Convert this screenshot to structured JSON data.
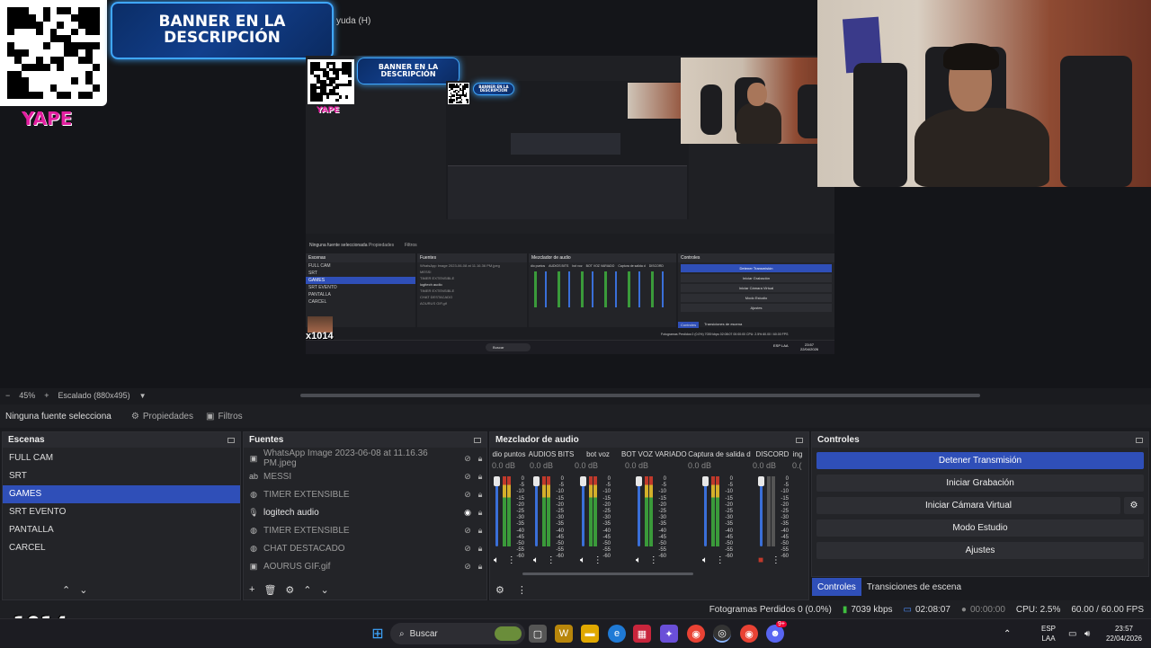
{
  "stream_overlay": {
    "banner_text": "BANNER EN LA DESCRIPCIÓN",
    "yape_label": "YAPE",
    "webcam_tag": "x1014"
  },
  "obs_menu": {
    "help_item": "yuda (H)"
  },
  "nested_preview": {
    "banner_text": "BANNER EN LA DESCRIPCIÓN",
    "yape_label": "YAPE",
    "context_label": "Ninguna fuente seleccionada",
    "properties": "Propiedades",
    "filters": "Filtros",
    "docks": [
      "Escenas",
      "Fuentes",
      "Mezclador de audio",
      "Controles"
    ],
    "scenes": [
      "FULL CAM",
      "SRT",
      "GAMES",
      "SRT EVENTO",
      "PANTALLA",
      "CARCEL"
    ],
    "sources": [
      "WhatsApp Image 2023-06-08 at 11.16.36 PM.jpeg",
      "MESSI",
      "TIMER EXTENSIBLE",
      "logitech audio",
      "TIMER EXTENSIBLE",
      "CHAT DESTACADO",
      "AOURUS GIF.gif"
    ],
    "mixer_channels": [
      "dio puntos",
      "AUDIOS BITS",
      "bot voz",
      "BOT VOZ VARIADO",
      "Captura de salida d",
      "DISCORD"
    ],
    "controls": [
      "Detener Transmisión",
      "Iniciar Grabación",
      "Iniciar Cámara Virtual",
      "Modo Estudio",
      "Ajustes"
    ],
    "tabs": [
      "Controles",
      "Transiciones de escena"
    ],
    "status": "Fotogramas Perdidos 0 (0.0%)  7039 kbps  02:08:07  00:00:00  CPU: 2.5%  60.00 / 60.00 FPS",
    "taskbar_search": "Buscar",
    "tray_lang": "ESP LAA",
    "tray_time": "23:57",
    "tray_date": "22/04/2026",
    "webcam_tag": "x1014"
  },
  "zoom": {
    "minus": "−",
    "value": "45%",
    "plus": "+",
    "mode": "Escalado (880x495)"
  },
  "context_bar": {
    "label": "Ninguna fuente selecciona",
    "properties": "Propiedades",
    "filters": "Filtros"
  },
  "scenes": {
    "title": "Escenas",
    "items": [
      "FULL CAM",
      "SRT",
      "GAMES",
      "SRT EVENTO",
      "PANTALLA",
      "CARCEL"
    ],
    "selected_index": 2
  },
  "sources": {
    "title": "Fuentes",
    "items": [
      {
        "name": "WhatsApp Image 2023-06-08 at 11.16.36 PM.jpeg",
        "icon": "image-icon",
        "visible": false
      },
      {
        "name": "MESSI",
        "icon": "text-icon",
        "visible": false
      },
      {
        "name": "TIMER EXTENSIBLE",
        "icon": "browser-icon",
        "visible": false
      },
      {
        "name": "logitech audio",
        "icon": "microphone-icon",
        "visible": true
      },
      {
        "name": "TIMER EXTENSIBLE",
        "icon": "browser-icon",
        "visible": false
      },
      {
        "name": "CHAT DESTACADO",
        "icon": "browser-icon",
        "visible": false
      },
      {
        "name": "AOURUS GIF.gif",
        "icon": "image-icon",
        "visible": false
      }
    ]
  },
  "mixer": {
    "title": "Mezclador de audio",
    "channels": [
      {
        "name": "dio puntos",
        "db": "0.0 dB"
      },
      {
        "name": "AUDIOS BITS",
        "db": "0.0 dB"
      },
      {
        "name": "bot voz",
        "db": "0.0 dB"
      },
      {
        "name": "BOT VOZ VARIADO",
        "db": "0.0 dB"
      },
      {
        "name": "Captura de salida d",
        "db": "0.0 dB"
      },
      {
        "name": "DISCORD",
        "db": "0.0 dB"
      },
      {
        "name": "ing",
        "db": "0.("
      }
    ],
    "scale": [
      "0",
      "-5",
      "-10",
      "-15",
      "-20",
      "-25",
      "-30",
      "-35",
      "-40",
      "-45",
      "-50",
      "-55",
      "-60"
    ]
  },
  "controls": {
    "title": "Controles",
    "stop_stream": "Detener Transmisión",
    "start_recording": "Iniciar Grabación",
    "start_virtual_cam": "Iniciar Cámara Virtual",
    "studio_mode": "Modo Estudio",
    "settings": "Ajustes"
  },
  "bottom_tabs": {
    "controls": "Controles",
    "transitions": "Transiciones de escena"
  },
  "status": {
    "dropped_frames": "Fotogramas Perdidos 0 (0.0%)",
    "bitrate": "7039 kbps",
    "stream_time": "02:08:07",
    "record_time": "00:00:00",
    "cpu": "CPU: 2.5%",
    "fps": "60.00 / 60.00 FPS"
  },
  "taskbar": {
    "search_placeholder": "Buscar",
    "lang_top": "ESP",
    "lang_bottom": "LAA",
    "time": "23:57",
    "date": "22/04/2026",
    "badge": "9+"
  },
  "colors": {
    "accent": "#2f4fb8",
    "bg": "#1a1b1f",
    "panel": "#232428",
    "yape": "#e21fa0"
  }
}
